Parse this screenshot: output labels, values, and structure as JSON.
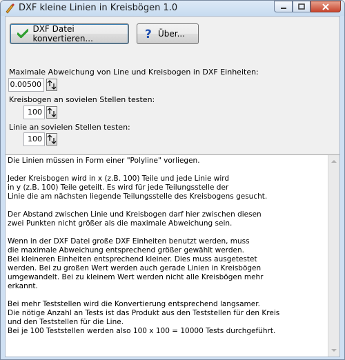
{
  "window": {
    "title": "DXF kleine Linien in Kreisbögen 1.0"
  },
  "toolbar": {
    "convert_label": "DXF Datei konvertieren...",
    "about_label": "Über..."
  },
  "settings": {
    "max_deviation_label": "Maximale Abweichung von Line und Kreisbogen in DXF Einheiten:",
    "max_deviation_value": "0.00500",
    "arc_points_label": "Kreisbogen an sovielen Stellen testen:",
    "arc_points_value": "100",
    "line_points_label": "Linie an sovielen Stellen testen:",
    "line_points_value": "100"
  },
  "memo": {
    "text": "Die Linien müssen in Form einer \"Polyline\" vorliegen.\n\nJeder Kreisbogen wird in x (z.B. 100) Teile und jede Linie wird\nin y (z.B. 100) Teile geteilt. Es wird für jede Teilungsstelle der\nLinie die am nächsten liegende Teilungsstelle des Kreisbogens gesucht.\n\nDer Abstand zwischen Linie und Kreisbogen darf hier zwischen diesen\nzwei Punkten nicht größer als die maximale Abweichung sein.\n\nWenn in der DXF Datei große DXF Einheiten benutzt werden, muss\ndie maximale Abweichung entsprechend größer gewählt werden.\nBei kleineren Einheiten entsprechend kleiner. Dies muss ausgetestet\nwerden. Bei zu großen Wert werden auch gerade Linien in Kreisbögen\numgewandelt. Bei zu kleinem Wert werden nicht alle Kreisbögen mehr\nerkannt.\n\nBei mehr Teststellen wird die Konvertierung entsprechend langsamer.\nDie nötige Anzahl an Tests ist das Produkt aus den Teststellen für den Kreis\nund den Teststellen für die Line.\nBei je 100 Teststellen werden also 100 x 100 = 10000 Tests durchgeführt."
  },
  "colors": {
    "check_green": "#2f9e2f",
    "question_blue": "#1f4fb0"
  }
}
